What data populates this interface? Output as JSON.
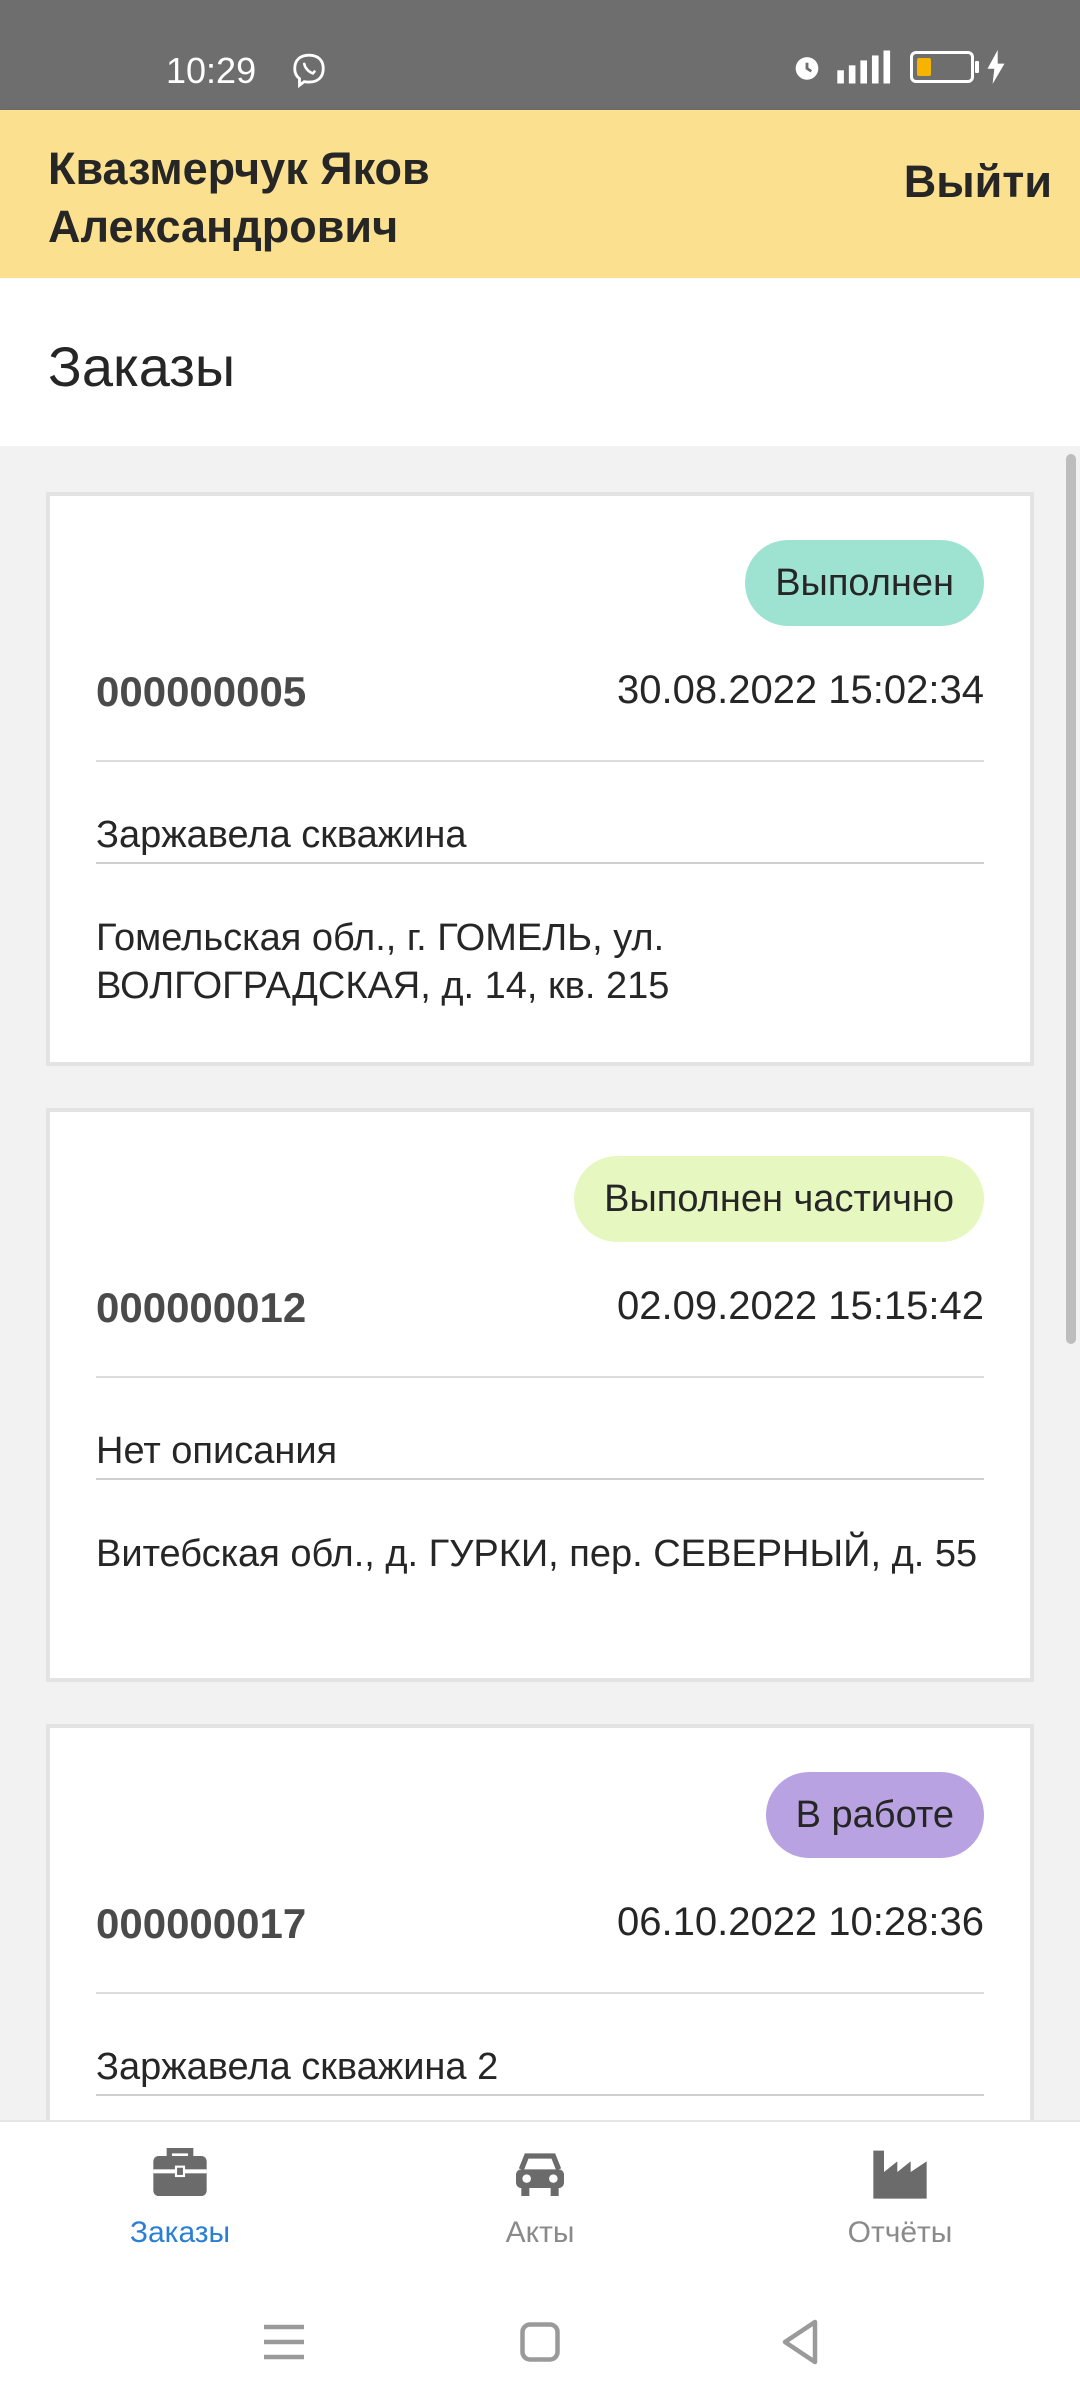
{
  "status_bar": {
    "time": "10:29",
    "icons": [
      "viber-icon",
      "alarm-icon",
      "signal-icon",
      "battery-icon",
      "charging-icon"
    ]
  },
  "header": {
    "user_name_line1": "Квазмерчук Яков",
    "user_name_line2": "Александрович",
    "logout": "Выйти"
  },
  "page": {
    "title": "Заказы"
  },
  "orders": [
    {
      "status": "Выполнен",
      "status_color": "#9ee3d2",
      "number": "000000005",
      "date": "30.08.2022 15:02:34",
      "description": "Заржавела скважина",
      "address": "Гомельская обл., г. ГОМЕЛЬ, ул. ВОЛГОГРАДСКАЯ, д. 14, кв. 215"
    },
    {
      "status": "Выполнен частично",
      "status_color": "#e6f7c0",
      "number": "000000012",
      "date": "02.09.2022 15:15:42",
      "description": "Нет описания",
      "address": "Витебская обл., д. ГУРКИ, пер. СЕВЕРНЫЙ, д. 55"
    },
    {
      "status": "В работе",
      "status_color": "#b9a2e2",
      "number": "000000017",
      "date": "06.10.2022 10:28:36",
      "description": "Заржавела скважина 2",
      "address": ""
    }
  ],
  "bottom_nav": [
    {
      "label": "Заказы",
      "icon": "briefcase-icon",
      "active": true
    },
    {
      "label": "Акты",
      "icon": "car-icon",
      "active": false
    },
    {
      "label": "Отчёты",
      "icon": "factory-icon",
      "active": false
    }
  ],
  "colors": {
    "header_bg": "#fbe18f",
    "active_tab": "#2a7fd4",
    "status_bar": "#6e6e6e"
  }
}
